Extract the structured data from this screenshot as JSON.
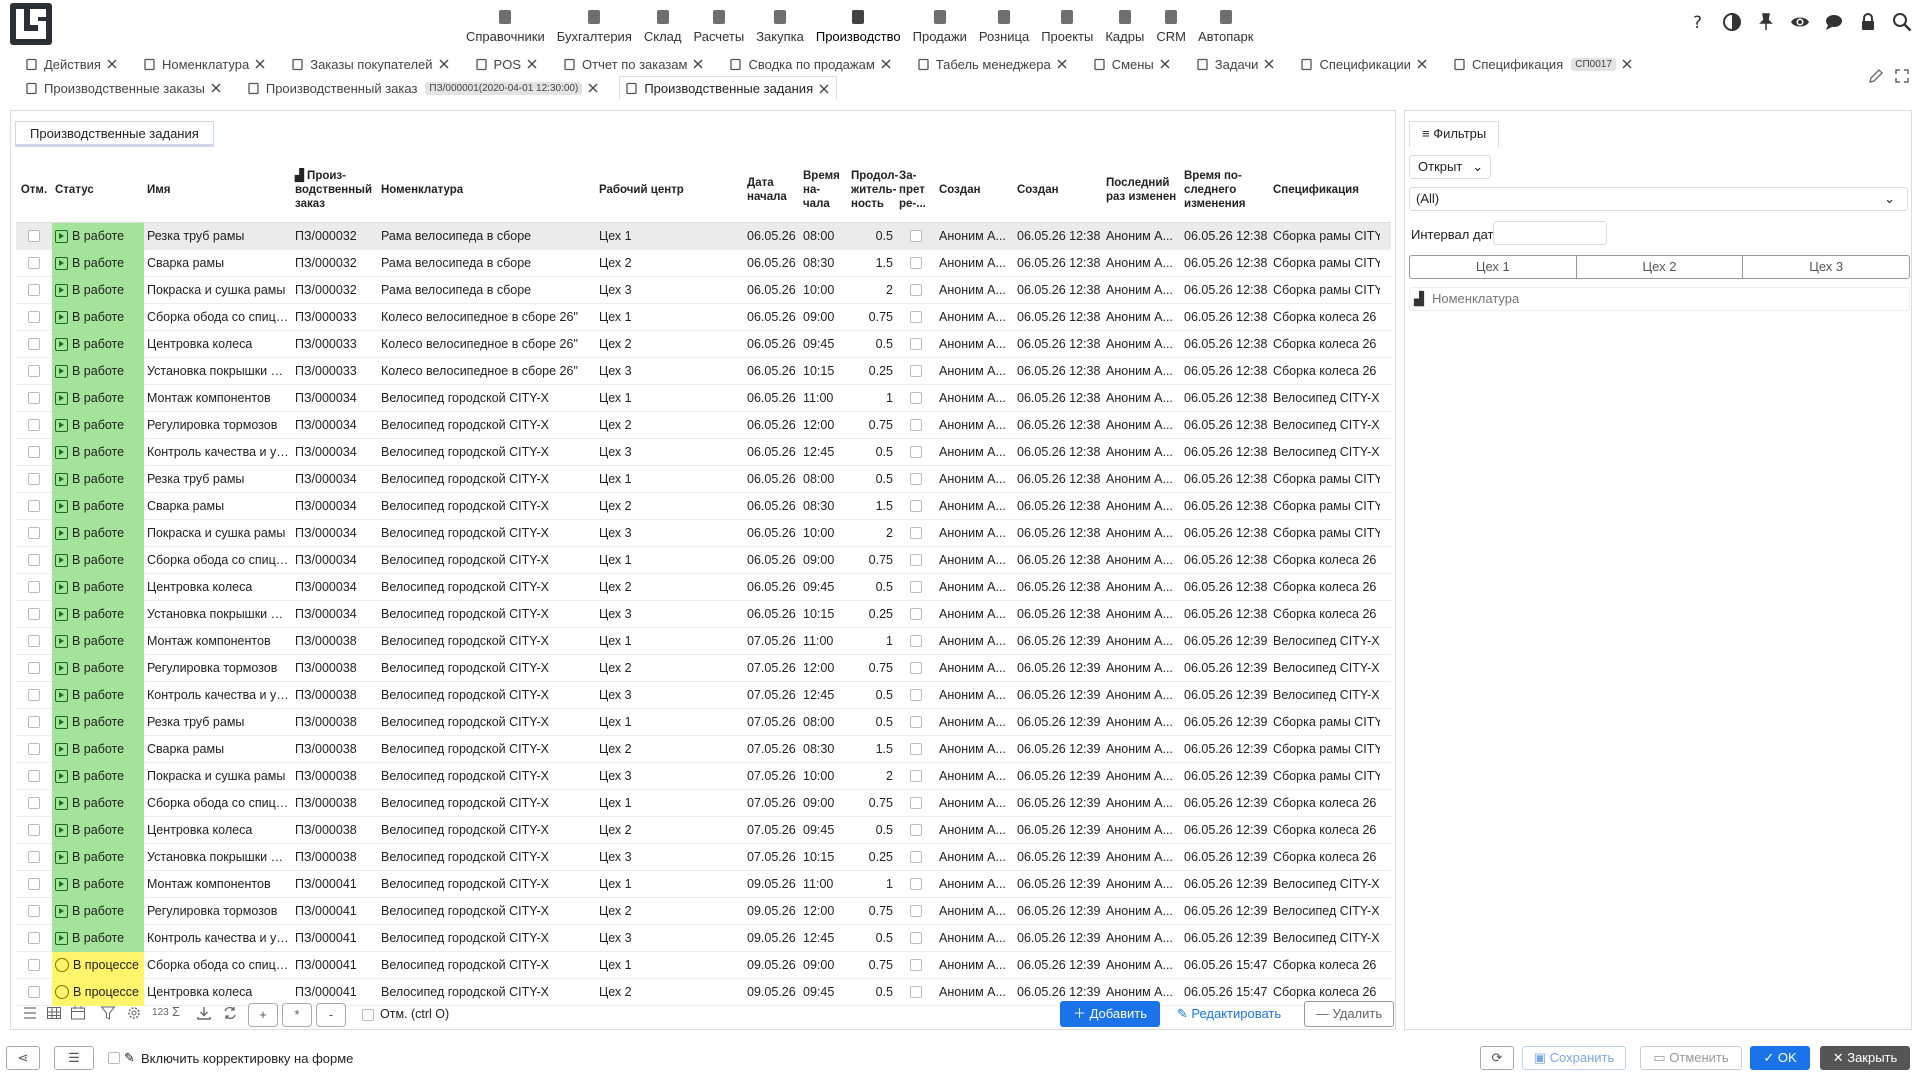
{
  "nav": [
    "Справочники",
    "Бухгалтерия",
    "Склад",
    "Расчеты",
    "Закупка",
    "Производство",
    "Продажи",
    "Розница",
    "Проекты",
    "Кадры",
    "CRM",
    "Автопарк"
  ],
  "tabs_row1": [
    {
      "label": "Действия",
      "icon": "chart"
    },
    {
      "label": "Номенклатура",
      "icon": "box"
    },
    {
      "label": "Заказы покупателей",
      "icon": "person"
    },
    {
      "label": "POS",
      "icon": "box"
    },
    {
      "label": "Отчет по заказам",
      "icon": "sort"
    },
    {
      "label": "Сводка по продажам",
      "icon": "person"
    },
    {
      "label": "Табель менеджера",
      "icon": "box"
    },
    {
      "label": "Смены",
      "icon": "gear"
    },
    {
      "label": "Задачи",
      "icon": "box"
    },
    {
      "label": "Спецификации",
      "icon": "doc"
    },
    {
      "label": "Спецификация",
      "icon": "doc",
      "badge": "СП0017"
    }
  ],
  "tabs_row2": [
    {
      "label": "Производственные заказы",
      "icon": "box"
    },
    {
      "label": "Производственный заказ",
      "icon": "factory",
      "badge": "ПЗ/000001(2020-04-01 12:30:00)"
    },
    {
      "label": "Производственные задания",
      "icon": "sort",
      "active": true
    }
  ],
  "panel_tab": "Производственные задания",
  "headers": {
    "chk": "Отм.",
    "status": "Статус",
    "name": "Имя",
    "order": "Произ-водственный заказ",
    "nom": "Номенклатура",
    "wc": "Рабочий центр",
    "date": "Дата начала",
    "time": "Время на-чала",
    "dur": "Продол-житель-ность",
    "ban": "За-прет ре-...",
    "createdby": "Создан",
    "created": "Создан",
    "lastby": "Последний раз изменен",
    "lasttime": "Время по-следнего изменения",
    "spec": "Спецификация"
  },
  "rows": [
    [
      "В работе",
      "Резка труб рамы",
      "ПЗ/000032",
      "Рама велосипеда в сборе",
      "Цех 1",
      "06.05.26",
      "08:00",
      "0.5",
      "Аноним А...",
      "06.05.26 12:38",
      "Аноним А...",
      "06.05.26 12:38",
      "Сборка рамы CITY"
    ],
    [
      "В работе",
      "Сварка рамы",
      "ПЗ/000032",
      "Рама велосипеда в сборе",
      "Цех 2",
      "06.05.26",
      "08:30",
      "1.5",
      "Аноним А...",
      "06.05.26 12:38",
      "Аноним А...",
      "06.05.26 12:38",
      "Сборка рамы CITY"
    ],
    [
      "В работе",
      "Покраска и сушка рамы",
      "ПЗ/000032",
      "Рама велосипеда в сборе",
      "Цех 3",
      "06.05.26",
      "10:00",
      "2",
      "Аноним А...",
      "06.05.26 12:38",
      "Аноним А...",
      "06.05.26 12:38",
      "Сборка рамы CITY"
    ],
    [
      "В работе",
      "Сборка обода со спицами",
      "ПЗ/000033",
      "Колесо велосипедное в сборе 26\"",
      "Цех 1",
      "06.05.26",
      "09:00",
      "0.75",
      "Аноним А...",
      "06.05.26 12:38",
      "Аноним А...",
      "06.05.26 12:38",
      "Сборка колеса 26"
    ],
    [
      "В работе",
      "Центровка колеса",
      "ПЗ/000033",
      "Колесо велосипедное в сборе 26\"",
      "Цех 2",
      "06.05.26",
      "09:45",
      "0.5",
      "Аноним А...",
      "06.05.26 12:38",
      "Аноним А...",
      "06.05.26 12:38",
      "Сборка колеса 26"
    ],
    [
      "В работе",
      "Установка покрышки и камеры",
      "ПЗ/000033",
      "Колесо велосипедное в сборе 26\"",
      "Цех 3",
      "06.05.26",
      "10:15",
      "0.25",
      "Аноним А...",
      "06.05.26 12:38",
      "Аноним А...",
      "06.05.26 12:38",
      "Сборка колеса 26"
    ],
    [
      "В работе",
      "Монтаж компонентов",
      "ПЗ/000034",
      "Велосипед городской CITY-X",
      "Цех 1",
      "06.05.26",
      "11:00",
      "1",
      "Аноним А...",
      "06.05.26 12:38",
      "Аноним А...",
      "06.05.26 12:38",
      "Велосипед CITY-X"
    ],
    [
      "В работе",
      "Регулировка тормозов",
      "ПЗ/000034",
      "Велосипед городской CITY-X",
      "Цех 2",
      "06.05.26",
      "12:00",
      "0.75",
      "Аноним А...",
      "06.05.26 12:38",
      "Аноним А...",
      "06.05.26 12:38",
      "Велосипед CITY-X"
    ],
    [
      "В работе",
      "Контроль качества и упаковка",
      "ПЗ/000034",
      "Велосипед городской CITY-X",
      "Цех 3",
      "06.05.26",
      "12:45",
      "0.5",
      "Аноним А...",
      "06.05.26 12:38",
      "Аноним А...",
      "06.05.26 12:38",
      "Велосипед CITY-X"
    ],
    [
      "В работе",
      "Резка труб рамы",
      "ПЗ/000034",
      "Велосипед городской CITY-X",
      "Цех 1",
      "06.05.26",
      "08:00",
      "0.5",
      "Аноним А...",
      "06.05.26 12:38",
      "Аноним А...",
      "06.05.26 12:38",
      "Сборка рамы CITY"
    ],
    [
      "В работе",
      "Сварка рамы",
      "ПЗ/000034",
      "Велосипед городской CITY-X",
      "Цех 2",
      "06.05.26",
      "08:30",
      "1.5",
      "Аноним А...",
      "06.05.26 12:38",
      "Аноним А...",
      "06.05.26 12:38",
      "Сборка рамы CITY"
    ],
    [
      "В работе",
      "Покраска и сушка рамы",
      "ПЗ/000034",
      "Велосипед городской CITY-X",
      "Цех 3",
      "06.05.26",
      "10:00",
      "2",
      "Аноним А...",
      "06.05.26 12:38",
      "Аноним А...",
      "06.05.26 12:38",
      "Сборка рамы CITY"
    ],
    [
      "В работе",
      "Сборка обода со спицами",
      "ПЗ/000034",
      "Велосипед городской CITY-X",
      "Цех 1",
      "06.05.26",
      "09:00",
      "0.75",
      "Аноним А...",
      "06.05.26 12:38",
      "Аноним А...",
      "06.05.26 12:38",
      "Сборка колеса 26"
    ],
    [
      "В работе",
      "Центровка колеса",
      "ПЗ/000034",
      "Велосипед городской CITY-X",
      "Цех 2",
      "06.05.26",
      "09:45",
      "0.5",
      "Аноним А...",
      "06.05.26 12:38",
      "Аноним А...",
      "06.05.26 12:38",
      "Сборка колеса 26"
    ],
    [
      "В работе",
      "Установка покрышки и камеры",
      "ПЗ/000034",
      "Велосипед городской CITY-X",
      "Цех 3",
      "06.05.26",
      "10:15",
      "0.25",
      "Аноним А...",
      "06.05.26 12:38",
      "Аноним А...",
      "06.05.26 12:38",
      "Сборка колеса 26"
    ],
    [
      "В работе",
      "Монтаж компонентов",
      "ПЗ/000038",
      "Велосипед городской CITY-X",
      "Цех 1",
      "07.05.26",
      "11:00",
      "1",
      "Аноним А...",
      "06.05.26 12:39",
      "Аноним А...",
      "06.05.26 12:39",
      "Велосипед CITY-X"
    ],
    [
      "В работе",
      "Регулировка тормозов",
      "ПЗ/000038",
      "Велосипед городской CITY-X",
      "Цех 2",
      "07.05.26",
      "12:00",
      "0.75",
      "Аноним А...",
      "06.05.26 12:39",
      "Аноним А...",
      "06.05.26 12:39",
      "Велосипед CITY-X"
    ],
    [
      "В работе",
      "Контроль качества и упаковка",
      "ПЗ/000038",
      "Велосипед городской CITY-X",
      "Цех 3",
      "07.05.26",
      "12:45",
      "0.5",
      "Аноним А...",
      "06.05.26 12:39",
      "Аноним А...",
      "06.05.26 12:39",
      "Велосипед CITY-X"
    ],
    [
      "В работе",
      "Резка труб рамы",
      "ПЗ/000038",
      "Велосипед городской CITY-X",
      "Цех 1",
      "07.05.26",
      "08:00",
      "0.5",
      "Аноним А...",
      "06.05.26 12:39",
      "Аноним А...",
      "06.05.26 12:39",
      "Сборка рамы CITY"
    ],
    [
      "В работе",
      "Сварка рамы",
      "ПЗ/000038",
      "Велосипед городской CITY-X",
      "Цех 2",
      "07.05.26",
      "08:30",
      "1.5",
      "Аноним А...",
      "06.05.26 12:39",
      "Аноним А...",
      "06.05.26 12:39",
      "Сборка рамы CITY"
    ],
    [
      "В работе",
      "Покраска и сушка рамы",
      "ПЗ/000038",
      "Велосипед городской CITY-X",
      "Цех 3",
      "07.05.26",
      "10:00",
      "2",
      "Аноним А...",
      "06.05.26 12:39",
      "Аноним А...",
      "06.05.26 12:39",
      "Сборка рамы CITY"
    ],
    [
      "В работе",
      "Сборка обода со спицами",
      "ПЗ/000038",
      "Велосипед городской CITY-X",
      "Цех 1",
      "07.05.26",
      "09:00",
      "0.75",
      "Аноним А...",
      "06.05.26 12:39",
      "Аноним А...",
      "06.05.26 12:39",
      "Сборка колеса 26"
    ],
    [
      "В работе",
      "Центровка колеса",
      "ПЗ/000038",
      "Велосипед городской CITY-X",
      "Цех 2",
      "07.05.26",
      "09:45",
      "0.5",
      "Аноним А...",
      "06.05.26 12:39",
      "Аноним А...",
      "06.05.26 12:39",
      "Сборка колеса 26"
    ],
    [
      "В работе",
      "Установка покрышки и камеры",
      "ПЗ/000038",
      "Велосипед городской CITY-X",
      "Цех 3",
      "07.05.26",
      "10:15",
      "0.25",
      "Аноним А...",
      "06.05.26 12:39",
      "Аноним А...",
      "06.05.26 12:39",
      "Сборка колеса 26"
    ],
    [
      "В работе",
      "Монтаж компонентов",
      "ПЗ/000041",
      "Велосипед городской CITY-X",
      "Цех 1",
      "09.05.26",
      "11:00",
      "1",
      "Аноним А...",
      "06.05.26 12:39",
      "Аноним А...",
      "06.05.26 12:39",
      "Велосипед CITY-X"
    ],
    [
      "В работе",
      "Регулировка тормозов",
      "ПЗ/000041",
      "Велосипед городской CITY-X",
      "Цех 2",
      "09.05.26",
      "12:00",
      "0.75",
      "Аноним А...",
      "06.05.26 12:39",
      "Аноним А...",
      "06.05.26 12:39",
      "Велосипед CITY-X"
    ],
    [
      "В работе",
      "Контроль качества и упаковка",
      "ПЗ/000041",
      "Велосипед городской CITY-X",
      "Цех 3",
      "09.05.26",
      "12:45",
      "0.5",
      "Аноним А...",
      "06.05.26 12:39",
      "Аноним А...",
      "06.05.26 12:39",
      "Велосипед CITY-X"
    ],
    [
      "В процессе",
      "Сборка обода со спицами",
      "ПЗ/000041",
      "Велосипед городской CITY-X",
      "Цех 1",
      "09.05.26",
      "09:00",
      "0.75",
      "Аноним А...",
      "06.05.26 12:39",
      "Аноним А...",
      "06.05.26 15:47",
      "Сборка колеса 26"
    ],
    [
      "В процессе",
      "Центровка колеса",
      "ПЗ/000041",
      "Велосипед городской CITY-X",
      "Цех 2",
      "09.05.26",
      "09:45",
      "0.5",
      "Аноним А...",
      "06.05.26 12:39",
      "Аноним А...",
      "06.05.26 15:47",
      "Сборка колеса 26"
    ]
  ],
  "status_colors": {
    "В работе": "#a4e39a",
    "В процессе": "#fff56a"
  },
  "bottom": {
    "count_label": "123",
    "mark_label": "Отм. (ctrl O)",
    "add": "Добавить",
    "edit": "Редактировать",
    "delete": "Удалить",
    "btn_plus": "+",
    "btn_star": "*",
    "btn_minus": "-"
  },
  "filters": {
    "tab": "Фильтры",
    "state": "Открыт",
    "all": "(All)",
    "interval_label": "Интервал дат",
    "workcenters": [
      "Цех 1",
      "Цех 2",
      "Цех 3"
    ],
    "nomenclature": "Номенклатура"
  },
  "footer": {
    "enable_label": "Включить корректировку на форме",
    "save": "Сохранить",
    "cancel": "Отменить",
    "ok": "OK",
    "close": "Закрыть"
  }
}
